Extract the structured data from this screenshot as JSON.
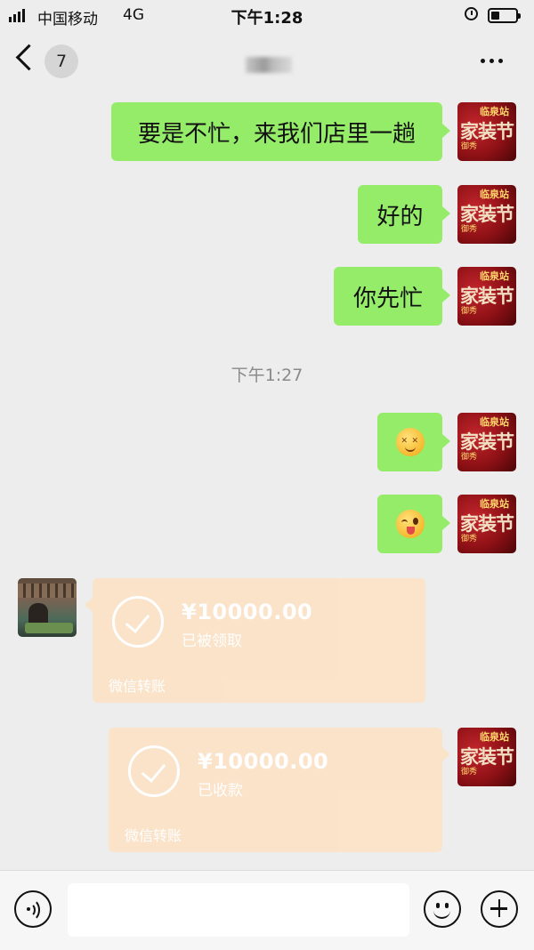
{
  "status_bar": {
    "carrier": "中国移动",
    "network": "4G",
    "time": "下午1:28"
  },
  "nav": {
    "unread_count": "7"
  },
  "messages": [
    {
      "text": "要是不忙，来我们店里一趟"
    },
    {
      "text": "好的"
    },
    {
      "text": "你先忙"
    }
  ],
  "timestamp": "下午1:27",
  "emojis": [
    "smile-dizzy-emoji",
    "wink-tongue-emoji"
  ],
  "avatar_right": {
    "line1": "临泉站",
    "line2": "家装节",
    "line3": "御秀"
  },
  "transfers": [
    {
      "amount": "¥10000.00",
      "status": "已被领取",
      "footer": "微信转账"
    },
    {
      "amount": "¥10000.00",
      "status": "已收款",
      "footer": "微信转账"
    }
  ],
  "input": {
    "placeholder": ""
  },
  "colors": {
    "bubble_green": "#95ec69",
    "transfer_bg": "#fbe3c8",
    "background": "#ededed"
  }
}
